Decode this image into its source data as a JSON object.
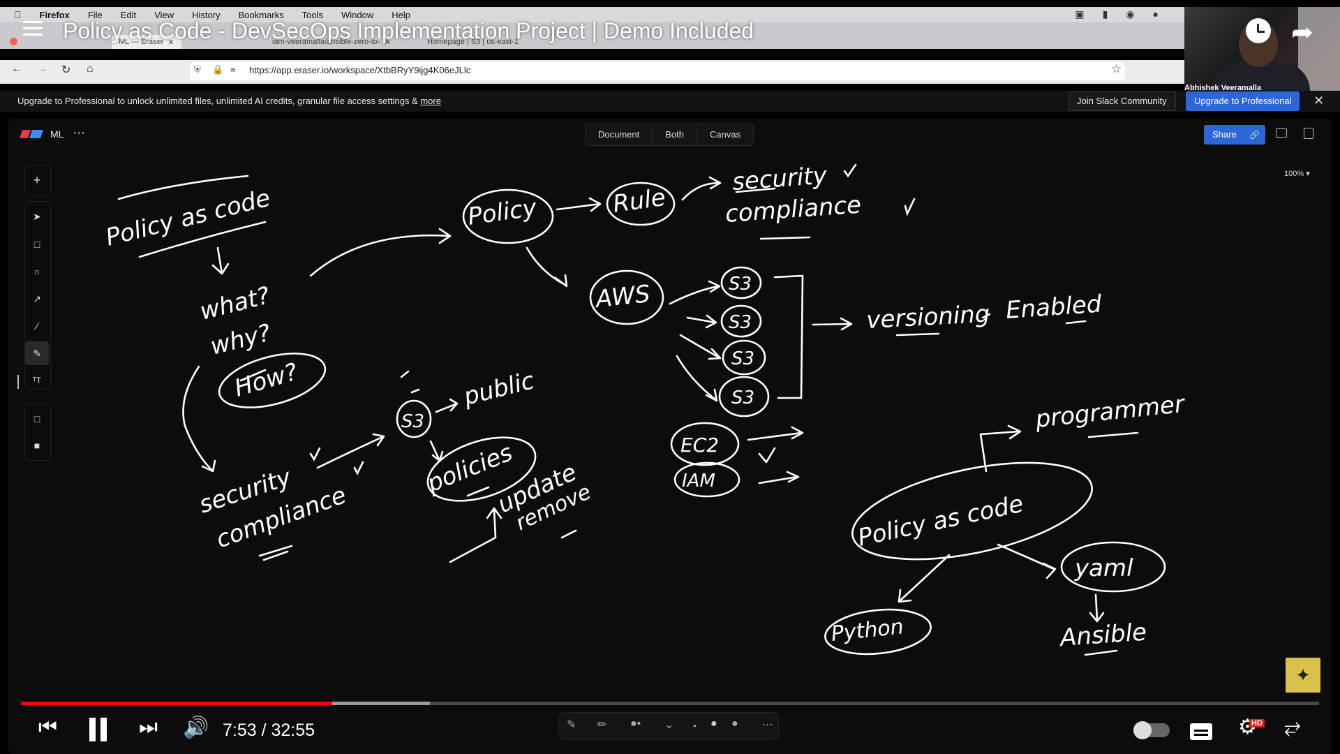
{
  "menubar": {
    "app_name": "Firefox",
    "items": [
      "File",
      "Edit",
      "View",
      "History",
      "Bookmarks",
      "Tools",
      "Window",
      "Help"
    ]
  },
  "browser": {
    "tabs": [
      {
        "label": "ML — Eraser"
      },
      {
        "label": "iam-veeramalla/ansible-zero-to-"
      },
      {
        "label": "Homepage | S3 | us-east-1"
      }
    ],
    "url": "https://app.eraser.io/workspace/XtbBRyY9ijg4K06eJLlc"
  },
  "video": {
    "title": "Policy as Code - DevSecOps Implementation Project | Demo Included",
    "presenter": "Abhishek Veeramalla",
    "current_time": "7:53",
    "duration": "32:55",
    "time_display": "7:53 / 32:55",
    "progress": 0.24,
    "buffered": 0.315,
    "hd_badge": "HD"
  },
  "banner": {
    "text": "Upgrade to Professional to unlock unlimited files, unlimited AI credits, granular file access settings & ",
    "more_link": "more",
    "slack_label": "Join Slack Community",
    "upgrade_label": "Upgrade to Professional"
  },
  "eraser": {
    "file_name": "ML",
    "view_tabs": [
      "Document",
      "Both",
      "Canvas"
    ],
    "share_label": "Share",
    "zoom_label": "100% ▾"
  },
  "drawing": {
    "texts": {
      "t1": "Policy as code",
      "t2": "what?",
      "t3": "why?",
      "t4": "How?",
      "t5": "security",
      "t6": "compliance",
      "t7": "S3",
      "t8": "public",
      "t9": "policies",
      "t10": "update",
      "t11": "remove",
      "t12": "Policy",
      "t13": "Rule",
      "t14": "security",
      "t15": "compliance",
      "t16": "AWS",
      "t17": "S3",
      "t18": "S3",
      "t19": "S3",
      "t20": "S3",
      "t21": "versioning",
      "t22": "Enabled",
      "t23": "EC2",
      "t24": "IAM",
      "t25": "programmer",
      "t26": "Policy as code",
      "t27": "Python",
      "t28": "yaml",
      "t29": "Ansible"
    }
  },
  "colors": {
    "progress_red": "#ff0000",
    "share_blue": "#2d66d8",
    "badge_yellow": "#d9c24a"
  }
}
